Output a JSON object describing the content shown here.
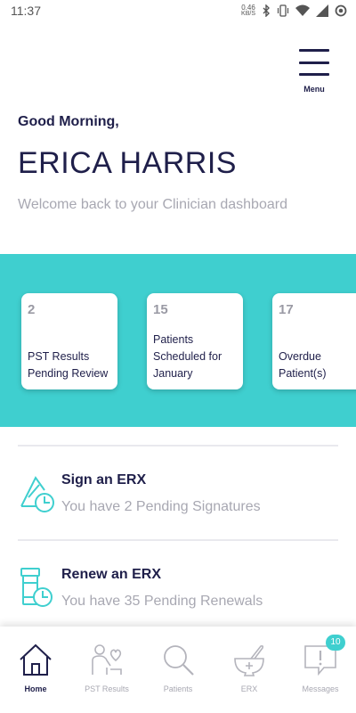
{
  "status_bar": {
    "time": "11:37",
    "net_speed_value": "0.46",
    "net_speed_unit": "KB/S",
    "icons": [
      "bluetooth-icon",
      "vibrate-icon",
      "wifi-icon",
      "signal-icon",
      "sync-icon"
    ]
  },
  "header": {
    "menu_label": "Menu",
    "greeting": "Good Morning,",
    "user_name": "ERICA HARRIS",
    "welcome": "Welcome back to your Clinician dashboard"
  },
  "stats": [
    {
      "value": "2",
      "label": "PST Results Pending Review"
    },
    {
      "value": "15",
      "label": "Patients Scheduled for January"
    },
    {
      "value": "17",
      "label": "Overdue Patient(s)"
    }
  ],
  "actions": [
    {
      "title": "Sign an ERX",
      "subtitle": "You have 2 Pending Signatures",
      "icon": "sign-erx-icon"
    },
    {
      "title": "Renew an ERX",
      "subtitle": "You have 35 Pending Renewals",
      "icon": "renew-erx-icon"
    }
  ],
  "bottom_nav": {
    "items": [
      {
        "label": "Home",
        "icon": "home-icon",
        "active": true
      },
      {
        "label": "PST Results",
        "icon": "pst-results-icon",
        "active": false
      },
      {
        "label": "Patients",
        "icon": "search-icon",
        "active": false
      },
      {
        "label": "ERX",
        "icon": "mortar-pestle-icon",
        "active": false
      },
      {
        "label": "Messages",
        "icon": "message-alert-icon",
        "active": false
      }
    ],
    "messages_badge": "10"
  },
  "colors": {
    "accent": "#3fcfcf",
    "navy": "#1f1f4a",
    "muted": "#a8a8b2"
  }
}
